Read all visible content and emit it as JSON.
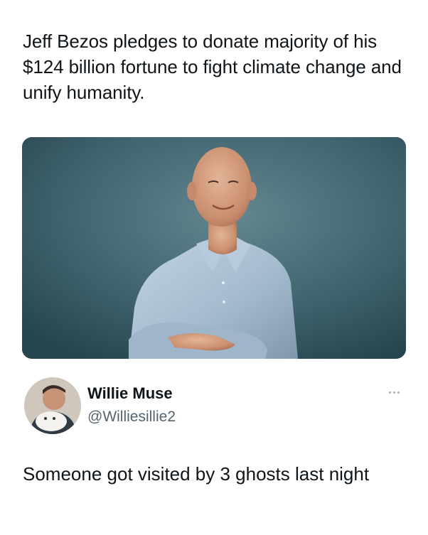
{
  "post": {
    "headline": "Jeff Bezos pledges to donate majority of his $124 billion fortune to fight climate change and unify humanity.",
    "image_name": "man-portrait-photo"
  },
  "reply": {
    "display_name": "Willie Muse",
    "handle": "@Williesillie2",
    "text": "Someone got visited by 3 ghosts last night",
    "more_icon": "ellipsis-icon"
  },
  "colors": {
    "text_primary": "#0f1419",
    "text_secondary": "#536471",
    "photo_background": "#3f626c",
    "shirt": "#a9c1d6"
  }
}
